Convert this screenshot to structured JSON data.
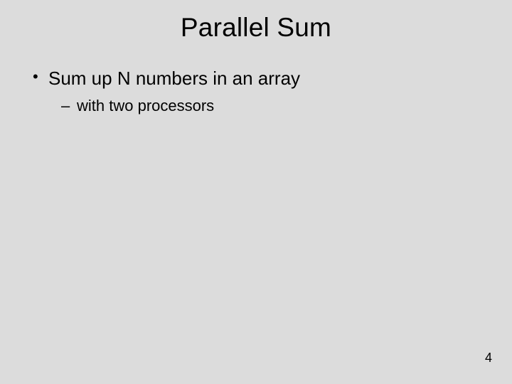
{
  "title": "Parallel Sum",
  "bullets": {
    "l1": "Sum up N numbers in an array",
    "l2": "with two processors"
  },
  "page_number": "4"
}
